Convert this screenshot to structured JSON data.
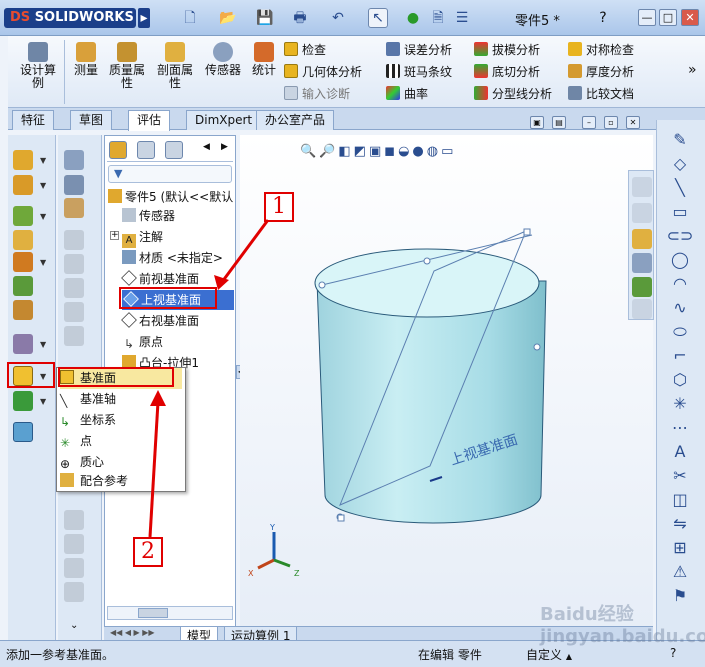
{
  "app": {
    "logo_text": "SOLIDWORKS",
    "logo_prefix": "DS",
    "document_title": "零件5 *"
  },
  "window_controls": {
    "help": "?",
    "minimize": "—",
    "maximize": "□",
    "close": "✕"
  },
  "ribbon": {
    "big_buttons": [
      {
        "label": "设计算\n例",
        "icon": "design-study-icon"
      },
      {
        "label": "测量",
        "icon": "measure-icon"
      },
      {
        "label": "质量属\n性",
        "icon": "mass-properties-icon"
      },
      {
        "label": "剖面属\n性",
        "icon": "section-properties-icon"
      },
      {
        "label": "传感器",
        "icon": "sensor-icon"
      },
      {
        "label": "统计",
        "icon": "statistics-icon"
      }
    ],
    "col1": [
      "检查",
      "几何体分析",
      "输入诊断"
    ],
    "col2": [
      "误差分析",
      "斑马条纹",
      "曲率"
    ],
    "col3": [
      "拔模分析",
      "底切分析",
      "分型线分析"
    ],
    "col4": [
      "对称检查",
      "厚度分析",
      "比较文档"
    ],
    "more": "»"
  },
  "tabs": [
    "特征",
    "草图",
    "评估",
    "DimXpert",
    "办公室产品"
  ],
  "active_tab": "评估",
  "tree": {
    "root": "零件5 (默认<<默认",
    "items": [
      "传感器",
      "注解",
      "材质 <未指定>",
      "前视基准面",
      "上视基准面",
      "右视基准面",
      "原点",
      "凸台-拉伸1"
    ],
    "selected": "上视基准面"
  },
  "context_menu": {
    "items": [
      "基准面",
      "基准轴",
      "坐标系",
      "点",
      "质心",
      "配合参考"
    ]
  },
  "callouts": {
    "one": "1",
    "two": "2"
  },
  "viewport": {
    "plane_label": "上视基准面",
    "triad": {
      "x": "X",
      "y": "Y",
      "z": "Z"
    }
  },
  "bottom_tabs": [
    "模型",
    "运动算例 1"
  ],
  "status": {
    "message": "添加一参考基准面。",
    "mode": "在编辑 零件",
    "custom": "自定义",
    "help": "?"
  },
  "watermark": "Baidu经验 jingyan.baidu.com"
}
